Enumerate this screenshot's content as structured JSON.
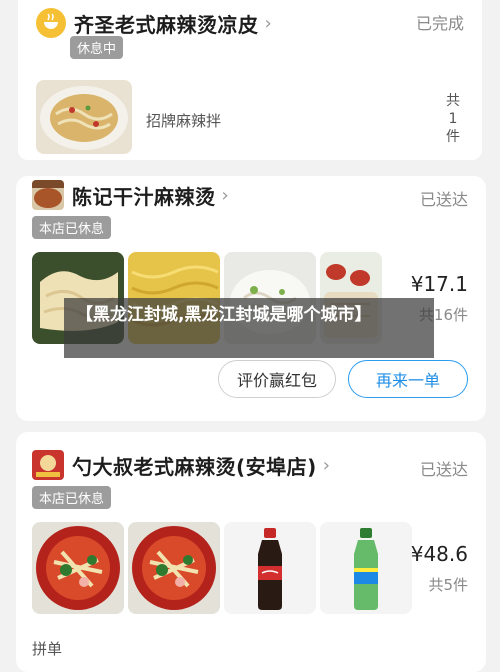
{
  "order1": {
    "shop_name": "齐圣老式麻辣烫凉皮",
    "status": "已完成",
    "badge": "休息中",
    "item_name": "招牌麻辣拌",
    "qty_lines": [
      "共",
      "1",
      "件"
    ]
  },
  "order2": {
    "shop_name": "陈记干汁麻辣烫",
    "status": "已送达",
    "badge": "本店已休息",
    "price": "¥17.1",
    "count": "共16件",
    "review_button": "评价赢红包",
    "reorder_button": "再来一单"
  },
  "order3": {
    "shop_name": "勺大叔老式麻辣烫(安埠店)",
    "status": "已送达",
    "badge": "本店已休息",
    "price": "¥48.6",
    "count": "共5件",
    "footer_text": "拼单"
  },
  "overlay": {
    "title": "【黑龙江封城,黑龙江封城是哪个城市】"
  },
  "colors": {
    "accent_blue": "#1f8ee6",
    "badge_gray": "#9c9c9c",
    "logo_yellow": "#f6c034"
  }
}
